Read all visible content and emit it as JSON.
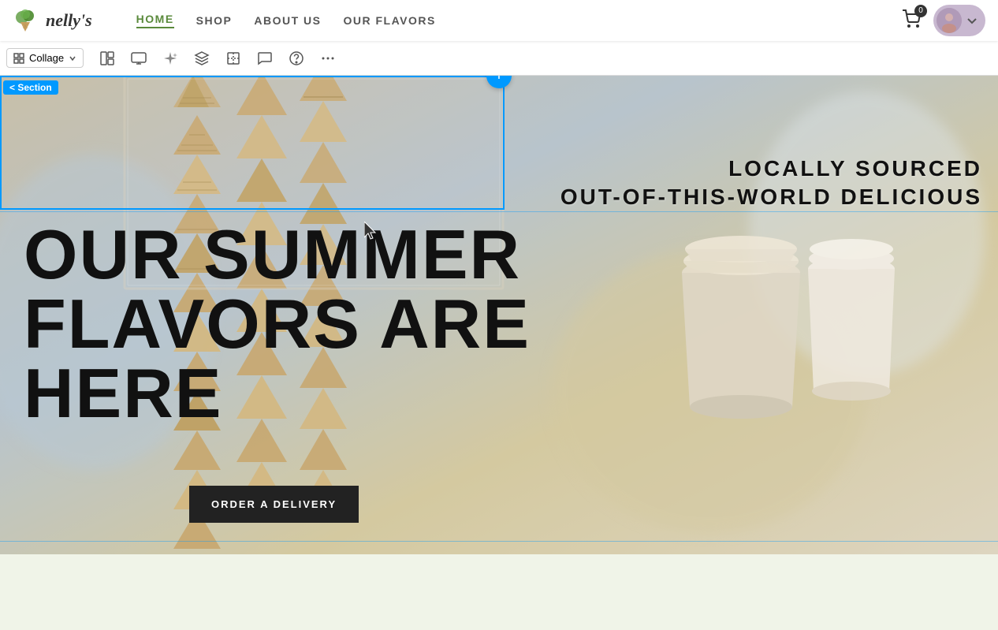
{
  "toolbar": {
    "logo_text": "nelly's",
    "nav": {
      "items": [
        {
          "id": "home",
          "label": "HOME",
          "active": true
        },
        {
          "id": "shop",
          "label": "SHOP",
          "active": false
        },
        {
          "id": "about",
          "label": "ABOUT US",
          "active": false
        },
        {
          "id": "flavors",
          "label": "OUR FLAVORS",
          "active": false
        }
      ]
    },
    "cart_count": "0",
    "collage_label": "Collage"
  },
  "edit_toolbar": {
    "tools": [
      {
        "id": "grid",
        "symbol": "⊞",
        "label": "grid-tool"
      },
      {
        "id": "layout",
        "symbol": "▤",
        "label": "layout-tool"
      },
      {
        "id": "ai",
        "symbol": "✦",
        "label": "ai-tool"
      },
      {
        "id": "layers",
        "symbol": "◈",
        "label": "layers-tool"
      },
      {
        "id": "crop",
        "symbol": "⬜",
        "label": "crop-tool"
      },
      {
        "id": "comment",
        "symbol": "💬",
        "label": "comment-tool"
      },
      {
        "id": "help",
        "symbol": "?",
        "label": "help-tool"
      },
      {
        "id": "more",
        "symbol": "•••",
        "label": "more-tool"
      }
    ]
  },
  "hero": {
    "section_badge": "Section",
    "add_btn_symbol": "+",
    "tagline1": "LOCALLY SOURCED",
    "tagline2": "OUT-OF-THIS-WORLD DELICIOUS",
    "headline_line1": "OUR SUMMER",
    "headline_line2": "FLAVORS ARE",
    "headline_line3": "HERE",
    "cta_label": "ORDER A DELIVERY"
  }
}
